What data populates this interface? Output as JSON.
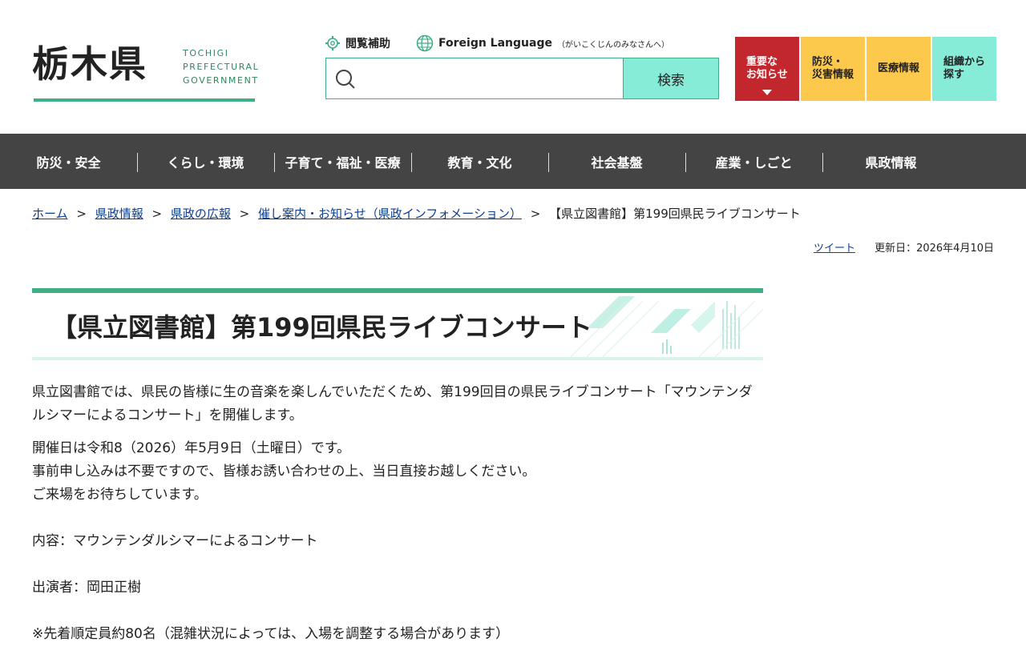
{
  "header": {
    "logo_kanji": "栃木県",
    "logo_en": [
      "TOCHIGI",
      "PREFECTURAL",
      "GOVERNMENT"
    ],
    "util": {
      "browse_assist": "閲覧補助",
      "foreign_language": "Foreign Language",
      "foreign_language_sub": "（がいこくじんのみなさんへ）"
    },
    "search": {
      "placeholder": "",
      "button": "検索"
    },
    "quick_links": [
      {
        "label": "重要な\nお知らせ",
        "color": "#c1272d"
      },
      {
        "label": "防災・\n災害情報",
        "color": "#fcc94d"
      },
      {
        "label": "医療情報",
        "color": "#fcc94d"
      },
      {
        "label": "組織から\n探す",
        "color": "#86ecd8"
      }
    ]
  },
  "nav": [
    "防災・安全",
    "くらし・環境",
    "子育て・福祉・医療",
    "教育・文化",
    "社会基盤",
    "産業・しごと",
    "県政情報"
  ],
  "breadcrumb": {
    "items": [
      "ホーム",
      "県政情報",
      "県政の広報",
      "催し案内・お知らせ（県政インフォメーション）"
    ],
    "separator": ">",
    "current": "【県立図書館】第199回県民ライブコンサート"
  },
  "meta": {
    "tweet": "ツイート",
    "updated": "更新日：2026年4月10日"
  },
  "article": {
    "title": "【県立図書館】第199回県民ライブコンサート",
    "intro": "県立図書館では、県民の皆様に生の音楽を楽しんでいただくため、第199回目の県民ライブコンサート「マウンテンダルシマーによるコンサート」を開催します。",
    "line1": "開催日は令和8（2026）年5月9日（土曜日）です。",
    "line2": "事前申し込みは不要ですので、皆様お誘い合わせの上、当日直接お越しください。",
    "line3": "ご来場をお待ちしています。",
    "content_line": "内容：マウンテンダルシマーによるコンサート",
    "performer_line": "出演者：岡田正樹",
    "note_line": "※先着順定員約80名（混雑状況によっては、入場を調整する場合があります）"
  },
  "colors": {
    "accent": "#3fae85",
    "mint": "#86ecd8",
    "red": "#c1272d",
    "yellow": "#fcc94d",
    "nav_bg": "#444444"
  }
}
